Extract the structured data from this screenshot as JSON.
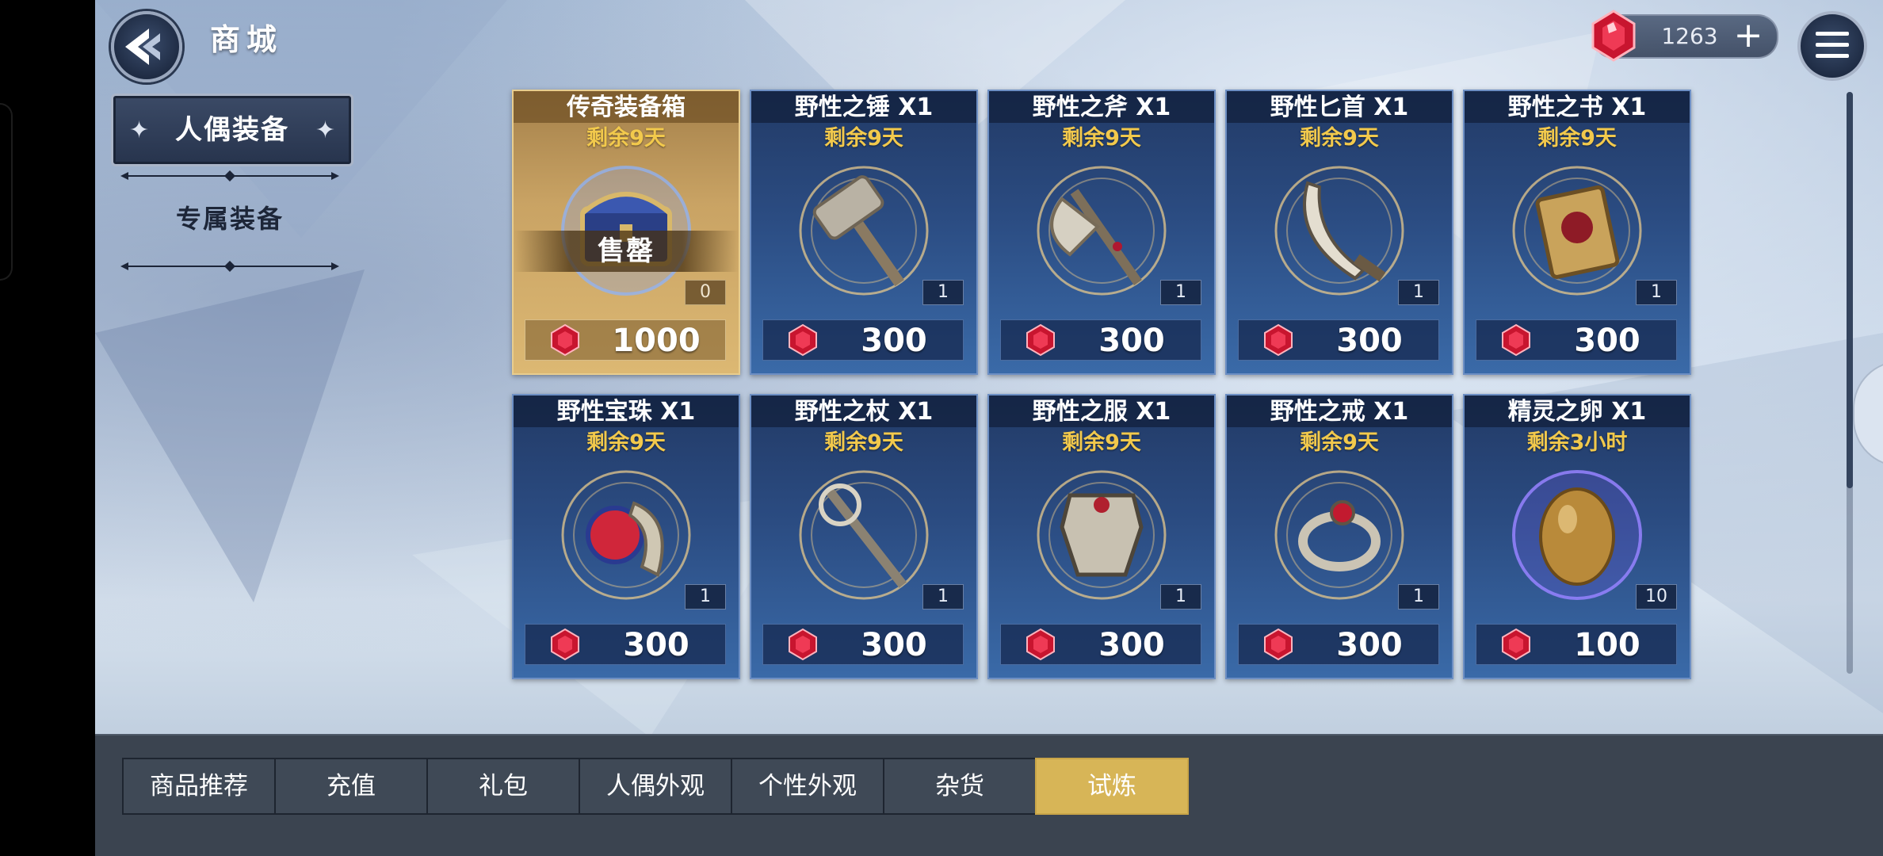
{
  "header": {
    "title": "商城",
    "currency": {
      "icon": "ruby-gem-icon",
      "amount": "1263",
      "add_label": "+"
    }
  },
  "categories": {
    "active": "人偶装备",
    "items": [
      "专属装备"
    ]
  },
  "products": [
    {
      "name": "传奇装备箱",
      "remaining": "剩余9天",
      "count": "0",
      "price": "1000",
      "sold_out": "售罄",
      "icon": "treasure-chest-icon"
    },
    {
      "name": "野性之锤 X1",
      "remaining": "剩余9天",
      "count": "1",
      "price": "300",
      "icon": "hammer-icon"
    },
    {
      "name": "野性之斧 X1",
      "remaining": "剩余9天",
      "count": "1",
      "price": "300",
      "icon": "axe-icon"
    },
    {
      "name": "野性匕首 X1",
      "remaining": "剩余9天",
      "count": "1",
      "price": "300",
      "icon": "dagger-icon"
    },
    {
      "name": "野性之书 X1",
      "remaining": "剩余9天",
      "count": "1",
      "price": "300",
      "icon": "book-icon"
    },
    {
      "name": "野性宝珠 X1",
      "remaining": "剩余9天",
      "count": "1",
      "price": "300",
      "icon": "orb-icon"
    },
    {
      "name": "野性之杖 X1",
      "remaining": "剩余9天",
      "count": "1",
      "price": "300",
      "icon": "staff-icon"
    },
    {
      "name": "野性之服 X1",
      "remaining": "剩余9天",
      "count": "1",
      "price": "300",
      "icon": "armor-icon"
    },
    {
      "name": "野性之戒 X1",
      "remaining": "剩余9天",
      "count": "1",
      "price": "300",
      "icon": "ring-icon"
    },
    {
      "name": "精灵之卵 X1",
      "remaining": "剩余3小时",
      "count": "10",
      "price": "100",
      "icon": "egg-icon"
    }
  ],
  "tabs": [
    {
      "label": "商品推荐",
      "active": false
    },
    {
      "label": "充值",
      "active": false
    },
    {
      "label": "礼包",
      "active": false
    },
    {
      "label": "人偶外观",
      "active": false
    },
    {
      "label": "个性外观",
      "active": false
    },
    {
      "label": "杂货",
      "active": false
    },
    {
      "label": "试炼",
      "active": true
    }
  ],
  "colors": {
    "accent_gold": "#d7b557",
    "price_gem": "#d81f3c",
    "remain_text": "#f2c94c"
  }
}
